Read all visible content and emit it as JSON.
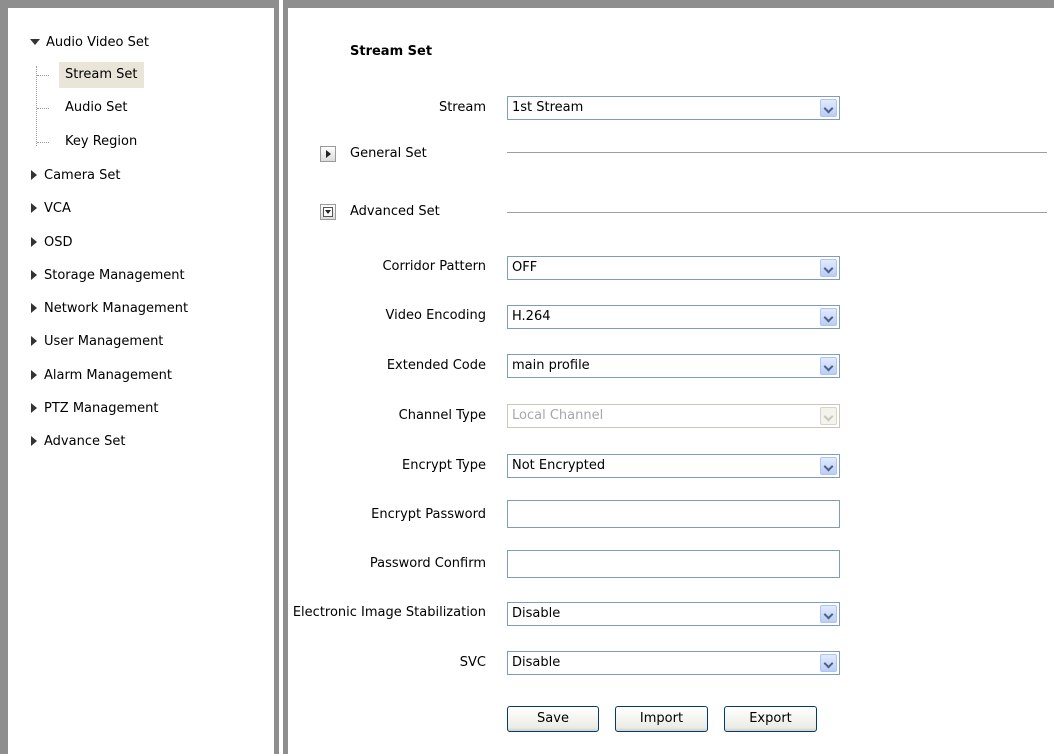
{
  "sidebar": {
    "root": {
      "label": "Audio Video Set"
    },
    "children": [
      {
        "label": "Stream Set",
        "selected": true
      },
      {
        "label": "Audio Set",
        "selected": false
      },
      {
        "label": "Key Region",
        "selected": false
      }
    ],
    "items": [
      {
        "label": "Camera Set"
      },
      {
        "label": "VCA"
      },
      {
        "label": "OSD"
      },
      {
        "label": "Storage Management"
      },
      {
        "label": "Network Management"
      },
      {
        "label": "User Management"
      },
      {
        "label": "Alarm Management"
      },
      {
        "label": "PTZ Management"
      },
      {
        "label": "Advance Set"
      }
    ]
  },
  "main": {
    "title": "Stream Set",
    "stream": {
      "label": "Stream",
      "value": "1st Stream"
    },
    "general_set": {
      "label": "General Set",
      "state": "collapsed"
    },
    "advanced_set": {
      "label": "Advanced Set",
      "state": "expanded"
    },
    "fields": {
      "corridor_pattern": {
        "label": "Corridor Pattern",
        "value": "OFF"
      },
      "video_encoding": {
        "label": "Video Encoding",
        "value": "H.264"
      },
      "extended_code": {
        "label": "Extended Code",
        "value": "main profile"
      },
      "channel_type": {
        "label": "Channel Type",
        "value": "Local Channel",
        "disabled": true
      },
      "encrypt_type": {
        "label": "Encrypt Type",
        "value": "Not Encrypted"
      },
      "encrypt_password": {
        "label": "Encrypt Password",
        "value": ""
      },
      "password_confirm": {
        "label": "Password Confirm",
        "value": ""
      },
      "eis": {
        "label": "Electronic Image Stabilization",
        "value": "Disable"
      },
      "svc": {
        "label": "SVC",
        "value": "Disable"
      }
    },
    "buttons": {
      "save": "Save",
      "import": "Import",
      "export": "Export"
    }
  },
  "colors": {
    "frame": "#8e8e8e",
    "selected_bg": "#e9e6d9",
    "input_border": "#7f9db9",
    "button_border": "#003c74"
  }
}
